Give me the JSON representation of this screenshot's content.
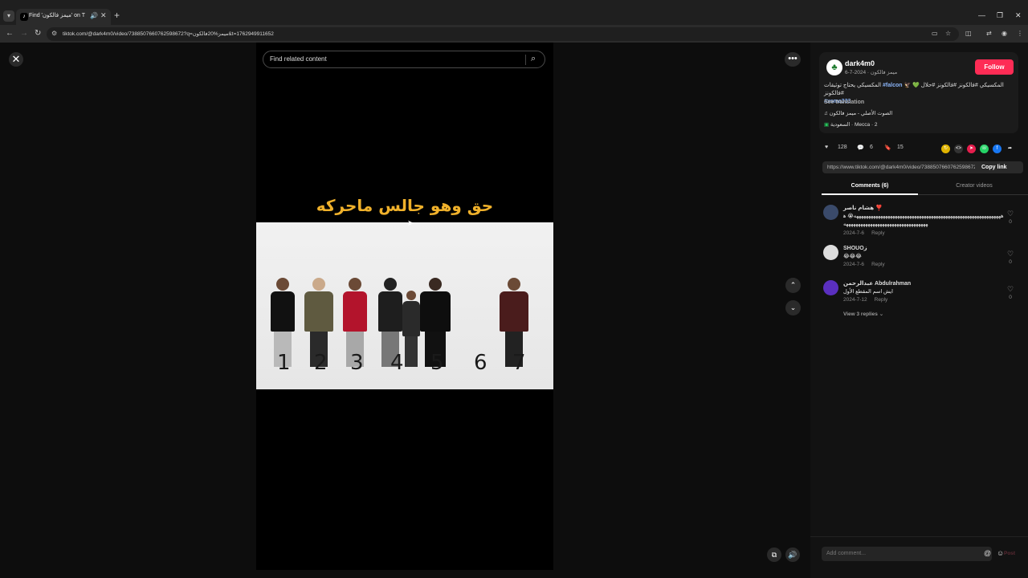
{
  "browser": {
    "tab_title": "Find 'ميمز فالكون' on TikTok",
    "url": "tiktok.com/@dark4m0/video/7388507660762598672?q=ميمز%20فالكون&t=1762949911652"
  },
  "page": {
    "search_placeholder": "Find related content",
    "video_caption": "حق وهو جالس ماحركه",
    "player_numbers": [
      "1",
      "2",
      "3",
      "4",
      "5",
      "6",
      "7"
    ]
  },
  "author": {
    "username": "dark4m0",
    "subline": "ميمز فالكون · 2024-7-6",
    "follow_label": "Follow",
    "description_text": "المكسيكي #فالكونز #فالكونز #حلال 💚 🦅 #فالكونز",
    "description_tag1": "#falcon",
    "description_tag2": "#xsma333",
    "description_tail": "المكسيكي يحتاج توثيقات",
    "see_translation": "See translation",
    "sound": "الصوت الأصلي - ميمز فالكون",
    "location": "السعودية · Mecca · 2"
  },
  "stats": {
    "likes": "128",
    "comments": "6",
    "saves": "15"
  },
  "share": {
    "link": "https://www.tiktok.com/@dark4m0/video/7388507660762598672...",
    "copy_label": "Copy link"
  },
  "tabs": {
    "comments": "Comments (6)",
    "creator_videos": "Creator videos"
  },
  "comments": [
    {
      "user": "هشام ناصر ❣️",
      "text": "هههههههههههههههههههههههههههههههههههههههههههههههههههههههههههههه😭 هههههههههههههههههههههههههههههههههههه",
      "date": "2024-7-6",
      "reply": "Reply",
      "likes": "0"
    },
    {
      "user": "SHOUOز",
      "text": "😂😂😂",
      "date": "2024-7-6",
      "reply": "Reply",
      "likes": "0"
    },
    {
      "user": "عبدالرحمن Abdulrahman",
      "text": "ايش اسم المقطع الأول",
      "date": "2024-7-12",
      "reply": "Reply",
      "likes": "0",
      "view_replies": "View 3 replies"
    }
  ],
  "comment_bar": {
    "placeholder": "Add comment...",
    "post_label": "Post"
  },
  "colors": {
    "accent": "#fe2c55",
    "caption": "#f0b12b",
    "tag": "#8ab4f8"
  }
}
